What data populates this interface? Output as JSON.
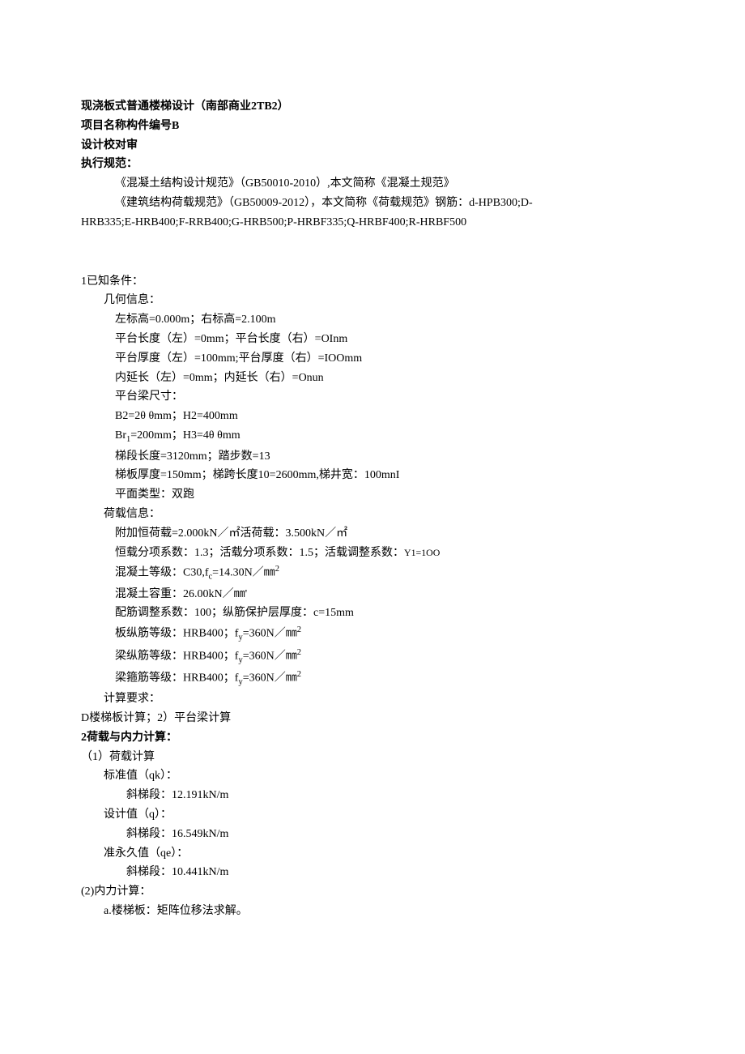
{
  "title_line": "现浇板式普通楼梯设计（南部商业2TB2）",
  "proj_line": "项目名称构件编号B",
  "check_line": "设计校对审",
  "spec_label": "执行规范：",
  "spec1": "《混凝土结构设计规范》（GB50010-2010）,本文简称《混凝土规范》",
  "spec2": "《建筑结构荷载规范》（GB50009-2012），本文简称《荷载规范》钢筋：d-HPB300;D-",
  "spec3": "HRB335;E-HRB400;F-RRB400;G-HRB500;P-HRBF335;Q-HRBF400;R-HRBF500",
  "s1_header": "1已知条件：",
  "geom_label": "几何信息：",
  "geom": {
    "l1": "左标高=0.000m；右标高=2.100m",
    "l2": "平台长度（左）=0mm；平台长度（右）=OInm",
    "l3": "平台厚度（左）=100mm;平台厚度（右）=IOOmm",
    "l4": "内延长（左）=0mm；内延长（右）=Onun",
    "l5": "平台梁尺寸：",
    "l6": "B2=2θ θmm；H2=400mm",
    "l7_pre": "Br",
    "l7_sub": "1",
    "l7_post": "=200mm；H3=4θ θmm",
    "l8": "梯段长度=3120mm；踏步数=13",
    "l9": "梯板厚度=150mm；梯跨长度10=2600mm,梯井宽：100mnI",
    "l10": "平面类型：双跑"
  },
  "load_label": "荷载信息：",
  "load": {
    "l1_a": "附加恒荷载=2.000kN／㎡",
    "l1_b": "活荷载：3.500kN／㎡",
    "l2_a": "恒载分项系数：1.3；活载分项系数：1.5；活载调整系数：",
    "l2_b": "Y1=1OO",
    "l3_a": "混凝土等级：C30,f",
    "l3_sub": "c",
    "l3_b": "=14.30N／㎜",
    "l3_sup": "2",
    "l4": "混凝土容重：26.00kN／㎜'",
    "l5": "配筋调整系数：100；纵筋保护层厚度：c=15mm",
    "l6_a": "板纵筋等级：HRB400；f",
    "l6_sub": "y",
    "l6_b": "=360N／㎜",
    "l7_a": "梁纵筋等级：HRB400；f",
    "l7_sub": "y",
    "l7_b": "=360N／㎜",
    "l8_a": "梁箍筋等级：HRB400；f",
    "l8_sub": "y",
    "l8_b": "=360N／㎜"
  },
  "calc_req_label": "计算要求：",
  "calc_req_line": "D楼梯板计算；2）平台梁计算",
  "s2_header": "2荷载与内力计算：",
  "s2": {
    "p1": "（1）荷载计算",
    "std_label": "标准值（qk）：",
    "std_val": "斜梯段：12.191kN/m",
    "des_label": "设计值（q）：",
    "des_val": "斜梯段：16.549kN/m",
    "qe_label": "准永久值（qe）：",
    "qe_val": "斜梯段：10.441kN/m",
    "p2": "(2)内力计算：",
    "p2a": "a.楼梯板：矩阵位移法求解。"
  }
}
